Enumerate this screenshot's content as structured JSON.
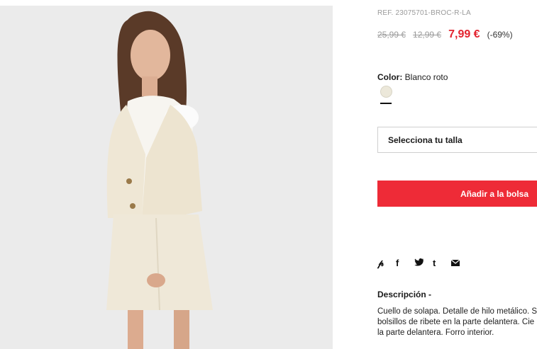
{
  "product": {
    "ref": "REF. 23075701-BROC-R-LA",
    "price_original": "25,99 €",
    "price_previous": "12,99 €",
    "price_current": "7,99 €",
    "discount": "(-69%)",
    "color_label": "Color:",
    "color_value": "Blanco roto",
    "size_select_label": "Selecciona tu talla",
    "add_to_bag_label": "Añadir a la bolsa",
    "description_title": "Descripción -",
    "description_lines": [
      "Cuello de solapa. Detalle de hilo metálico. S",
      "bolsillos de ribete en la parte delantera. Cie",
      "la parte delantera. Forro interior."
    ]
  },
  "share_icons": [
    "pinterest-icon",
    "facebook-icon",
    "twitter-icon",
    "tumblr-icon",
    "email-icon"
  ],
  "colors": {
    "accent": "#ee2b37",
    "price_red": "#e3232f",
    "swatch": "#ece8da"
  }
}
